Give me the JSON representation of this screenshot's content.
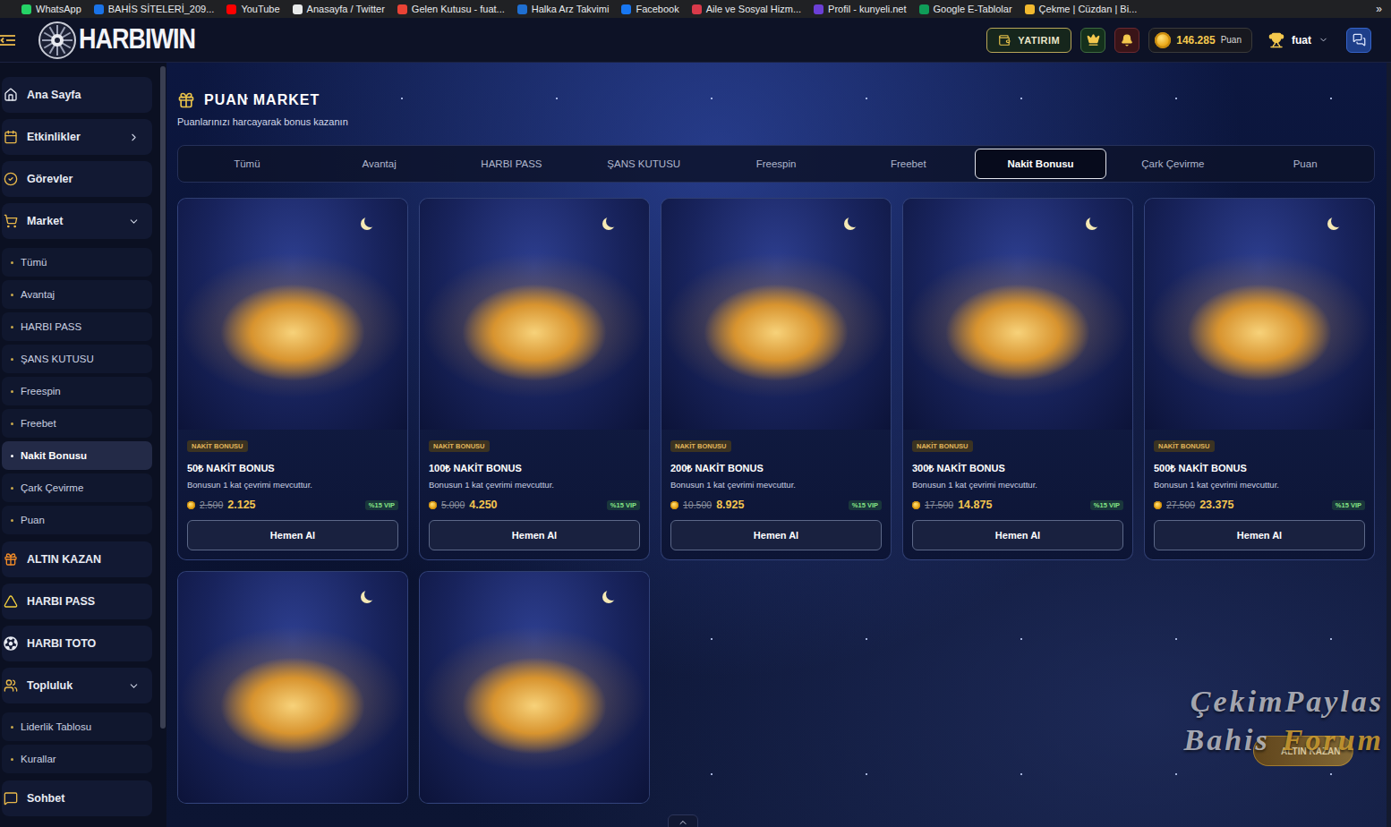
{
  "bookmarks": [
    {
      "label": "WhatsApp",
      "color": "#25d366"
    },
    {
      "label": "BAHİS SİTELERİ_209...",
      "color": "#1a73e8"
    },
    {
      "label": "YouTube",
      "color": "#ff0000"
    },
    {
      "label": "Anasayfa / Twitter",
      "color": "#e7e9ea"
    },
    {
      "label": "Gelen Kutusu - fuat...",
      "color": "#ea4335"
    },
    {
      "label": "Halka Arz Takvimi",
      "color": "#1f6fd1"
    },
    {
      "label": "Facebook",
      "color": "#1877f2"
    },
    {
      "label": "Aile ve Sosyal Hizm...",
      "color": "#d93a4a"
    },
    {
      "label": "Profil - kunyeli.net",
      "color": "#6b3fd6"
    },
    {
      "label": "Google E-Tablolar",
      "color": "#0f9d58"
    },
    {
      "label": "Çekme | Cüzdan | Bi...",
      "color": "#f3ba2f"
    }
  ],
  "bookmarks_more": "»",
  "header": {
    "logo": "HARBIWIN",
    "deposit": "YATIRIM",
    "points": "146.285",
    "points_unit": "Puan",
    "user": "fuat"
  },
  "sidebar": {
    "items": [
      {
        "label": "Ana Sayfa",
        "expandable": false,
        "expanded": false,
        "children": []
      },
      {
        "label": "Etkinlikler",
        "expandable": true,
        "expanded": false,
        "children": []
      },
      {
        "label": "Görevler",
        "expandable": false,
        "expanded": false,
        "children": []
      },
      {
        "label": "Market",
        "expandable": true,
        "expanded": true,
        "children": [
          {
            "label": "Tümü",
            "selected": false
          },
          {
            "label": "Avantaj",
            "selected": false
          },
          {
            "label": "HARBI PASS",
            "selected": false
          },
          {
            "label": "ŞANS KUTUSU",
            "selected": false
          },
          {
            "label": "Freespin",
            "selected": false
          },
          {
            "label": "Freebet",
            "selected": false
          },
          {
            "label": "Nakit Bonusu",
            "selected": true
          },
          {
            "label": "Çark Çevirme",
            "selected": false
          },
          {
            "label": "Puan",
            "selected": false
          }
        ]
      },
      {
        "label": "ALTIN KAZAN",
        "expandable": false,
        "expanded": false,
        "children": []
      },
      {
        "label": "HARBI PASS",
        "expandable": false,
        "expanded": false,
        "children": []
      },
      {
        "label": "HARBI TOTO",
        "expandable": false,
        "expanded": false,
        "children": []
      },
      {
        "label": "Topluluk",
        "expandable": true,
        "expanded": true,
        "children": [
          {
            "label": "Liderlik Tablosu",
            "selected": false
          },
          {
            "label": "Kurallar",
            "selected": false
          }
        ]
      },
      {
        "label": "Sohbet",
        "expandable": false,
        "expanded": false,
        "children": []
      }
    ]
  },
  "page": {
    "title": "PUAN MARKET",
    "subtitle": "Puanlarınızı harcayarak bonus kazanın"
  },
  "tabs": [
    {
      "label": "Tümü",
      "selected": false
    },
    {
      "label": "Avantaj",
      "selected": false
    },
    {
      "label": "HARBI PASS",
      "selected": false
    },
    {
      "label": "ŞANS KUTUSU",
      "selected": false
    },
    {
      "label": "Freespin",
      "selected": false
    },
    {
      "label": "Freebet",
      "selected": false
    },
    {
      "label": "Nakit Bonusu",
      "selected": true
    },
    {
      "label": "Çark Çevirme",
      "selected": false
    },
    {
      "label": "Puan",
      "selected": false
    }
  ],
  "cards": [
    {
      "kind": "full",
      "tag": "NAKİT BONUSU",
      "title": "50₺ NAKİT BONUS",
      "description": "Bonusun 1 kat çevrimi mevcuttur.",
      "old_price": "2.500",
      "price": "2.125",
      "vip": "%15 VIP",
      "button": "Hemen Al"
    },
    {
      "kind": "full",
      "tag": "NAKİT BONUSU",
      "title": "100₺ NAKİT BONUS",
      "description": "Bonusun 1 kat çevrimi mevcuttur.",
      "old_price": "5.000",
      "price": "4.250",
      "vip": "%15 VIP",
      "button": "Hemen Al"
    },
    {
      "kind": "full",
      "tag": "NAKİT BONUSU",
      "title": "200₺ NAKİT BONUS",
      "description": "Bonusun 1 kat çevrimi mevcuttur.",
      "old_price": "10.500",
      "price": "8.925",
      "vip": "%15 VIP",
      "button": "Hemen Al"
    },
    {
      "kind": "full",
      "tag": "NAKİT BONUSU",
      "title": "300₺ NAKİT BONUS",
      "description": "Bonusun 1 kat çevrimi mevcuttur.",
      "old_price": "17.500",
      "price": "14.875",
      "vip": "%15 VIP",
      "button": "Hemen Al"
    },
    {
      "kind": "full",
      "tag": "NAKİT BONUSU",
      "title": "500₺ NAKİT BONUS",
      "description": "Bonusun 1 kat çevrimi mevcuttur.",
      "old_price": "27.500",
      "price": "23.375",
      "vip": "%15 VIP",
      "button": "Hemen Al"
    },
    {
      "kind": "image"
    },
    {
      "kind": "image"
    }
  ],
  "watermark": {
    "line1": "ÇekimPaylas",
    "line2a": "Bahis",
    "line2b": "Forum"
  },
  "floating_button": "ALTIN KAZAN"
}
